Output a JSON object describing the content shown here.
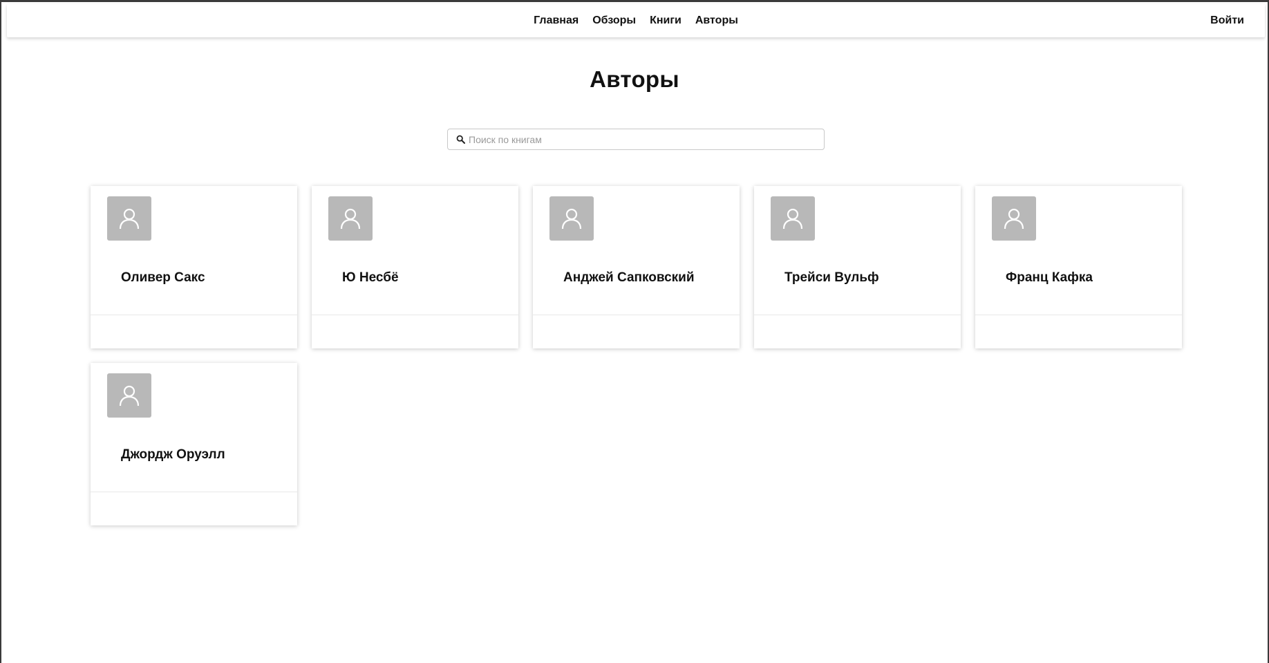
{
  "nav": {
    "links": [
      {
        "label": "Главная"
      },
      {
        "label": "Обзоры"
      },
      {
        "label": "Книги"
      },
      {
        "label": "Авторы"
      }
    ],
    "login_label": "Войти"
  },
  "page": {
    "title": "Авторы"
  },
  "search": {
    "placeholder": "Поиск по книгам",
    "value": "",
    "icon": "search-icon"
  },
  "authors": [
    {
      "name": "Оливер Сакс",
      "avatar_icon": "user-icon"
    },
    {
      "name": "Ю Несбё",
      "avatar_icon": "user-icon"
    },
    {
      "name": "Анджей Сапковский",
      "avatar_icon": "user-icon"
    },
    {
      "name": "Трейси Вульф",
      "avatar_icon": "user-icon"
    },
    {
      "name": "Франц Кафка",
      "avatar_icon": "user-icon"
    },
    {
      "name": "Джордж Оруэлл",
      "avatar_icon": "user-icon"
    }
  ],
  "colors": {
    "avatar_background": "#b8b8b8",
    "text": "#111111",
    "page_background": "#ffffff"
  }
}
